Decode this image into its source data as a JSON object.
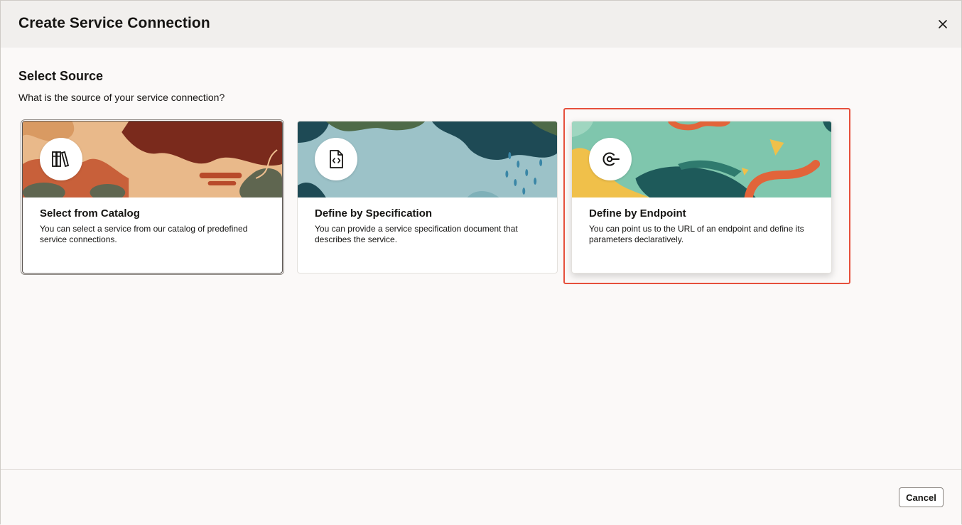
{
  "dialog": {
    "title": "Create Service Connection",
    "close_icon": "close-icon"
  },
  "section": {
    "title": "Select Source",
    "subtitle": "What is the source of your service connection?"
  },
  "cards": [
    {
      "title": "Select from Catalog",
      "description": "You can select a service from our catalog of predefined service connections.",
      "icon": "catalog-books-icon",
      "colors": {
        "bg": "#e9b98a",
        "accent1": "#7a2a1c",
        "accent2": "#c8603a",
        "accent3": "#5f6650"
      }
    },
    {
      "title": "Define by Specification",
      "description": "You can provide a service specification document that describes the service.",
      "icon": "code-document-icon",
      "colors": {
        "bg": "#9cc2c8",
        "accent1": "#1e4a55",
        "accent2": "#4e6a48",
        "accent3": "#3a86a6"
      }
    },
    {
      "title": "Define by Endpoint",
      "description": "You can point us to the URL of an endpoint and define its parameters declaratively.",
      "icon": "endpoint-icon",
      "colors": {
        "bg": "#7fc6ad",
        "accent1": "#1e5a5a",
        "accent2": "#e2643a",
        "accent3": "#f0c04a"
      }
    }
  ],
  "footer": {
    "cancel_label": "Cancel"
  },
  "colors": {
    "highlight": "#e6503c",
    "header_bg": "#f1efed"
  }
}
